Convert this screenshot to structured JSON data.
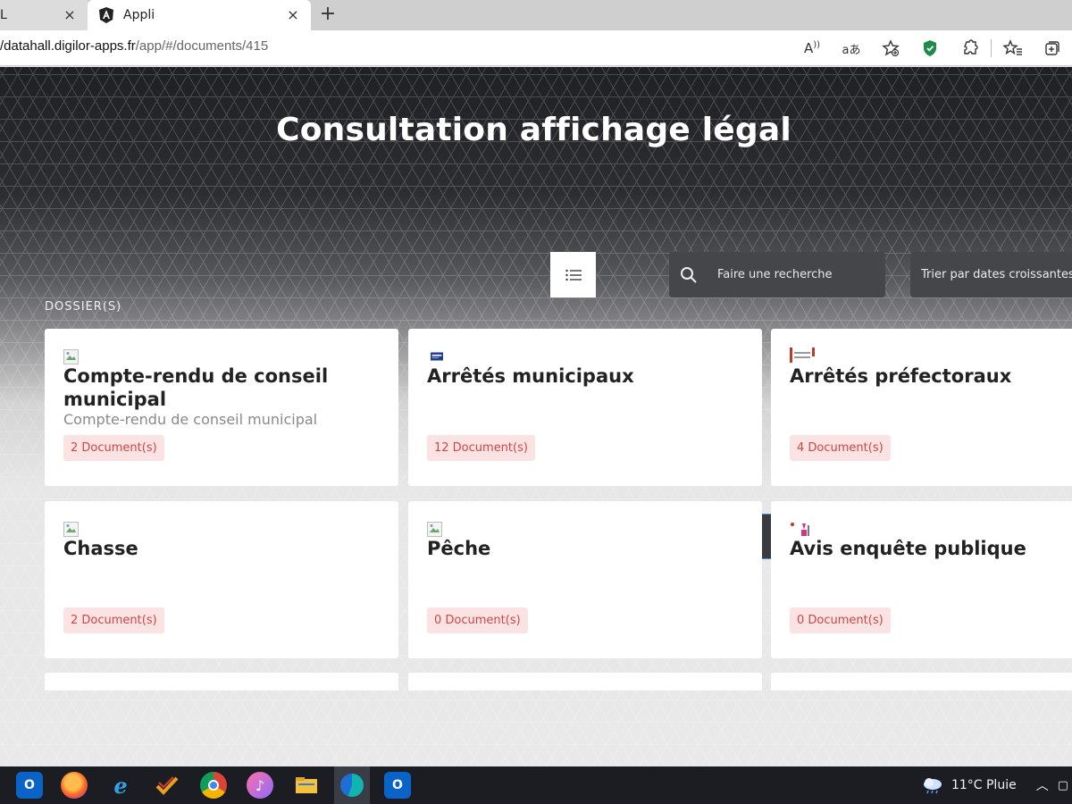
{
  "browser": {
    "tabs": [
      {
        "title": "L",
        "active": false
      },
      {
        "title": "Appli",
        "active": true
      }
    ],
    "close_glyph": "×",
    "new_tab_glyph": "+",
    "url_host": "/datahall.digilor-apps.fr",
    "url_path": "/app/#/documents/415",
    "icons": [
      "read-aloud-icon",
      "translate-icon",
      "add-favorite-icon",
      "shield-icon",
      "extensions-icon",
      "favorites-icon",
      "collections-icon"
    ],
    "read_aloud_glyph": "A",
    "translate_glyph": "aあ"
  },
  "page": {
    "title": "Consultation affichage légal",
    "section_label": "DOSSIER(S)",
    "search": {
      "placeholder": "Faire une recherche"
    },
    "sort": {
      "selected": "Trier par dates croissantes"
    },
    "view": {
      "active": "list"
    }
  },
  "folders": [
    {
      "title": "Compte-rendu de conseil municipal",
      "subtitle": "Compte-rendu de conseil municipal",
      "badge": "2 Document(s)"
    },
    {
      "title": "Arrêtés municipaux",
      "subtitle": "",
      "badge": "12 Document(s)"
    },
    {
      "title": "Arrêtés préfectoraux",
      "subtitle": "",
      "badge": "4 Document(s)"
    },
    {
      "title": "Chasse",
      "subtitle": "",
      "badge": "2 Document(s)"
    },
    {
      "title": "Pêche",
      "subtitle": "",
      "badge": "0 Document(s)"
    },
    {
      "title": "Avis enquête publique",
      "subtitle": "",
      "badge": "0 Document(s)"
    }
  ],
  "taskbar": {
    "apps": [
      "outlook-icon",
      "firefox-icon",
      "internet-explorer-icon",
      "task-icon",
      "chrome-icon",
      "itunes-icon",
      "file-explorer-icon",
      "edge-icon",
      "outlook-mail-icon"
    ],
    "weather": "11°C Pluie",
    "colors": {
      "accent": "#4a90d9",
      "badge_bg": "#fbe3e3",
      "badge_text": "#d14545"
    }
  }
}
